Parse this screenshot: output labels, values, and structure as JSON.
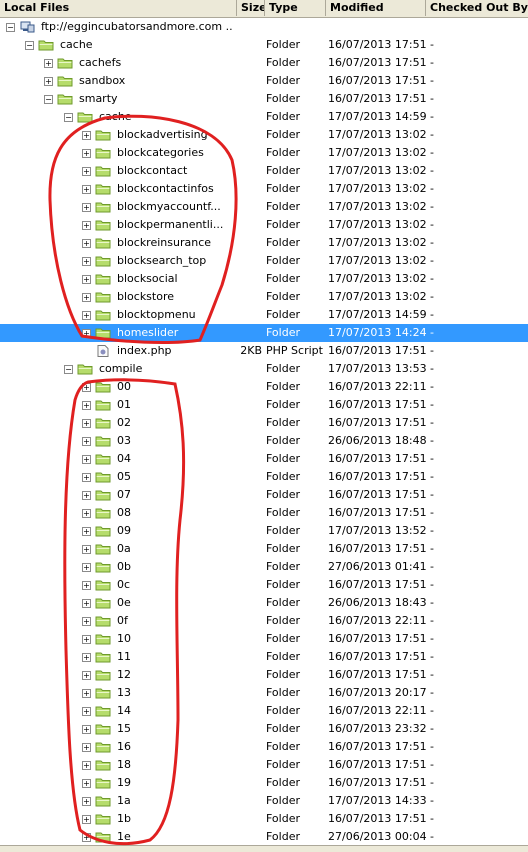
{
  "columns": {
    "local_files": "Local Files",
    "size": "Size",
    "type": "Type",
    "modified": "Modified",
    "checked_out_by": "Checked Out By"
  },
  "rows": [
    {
      "name": "ftp://eggincubatorsandmore.com ...",
      "size": "",
      "type": "",
      "modified": "",
      "checked": "",
      "level": 0,
      "icon": "server",
      "expander": "minus"
    },
    {
      "name": "cache",
      "size": "",
      "type": "Folder",
      "modified": "16/07/2013 17:51",
      "checked": "-",
      "level": 1,
      "icon": "folder",
      "expander": "minus"
    },
    {
      "name": "cachefs",
      "size": "",
      "type": "Folder",
      "modified": "16/07/2013 17:51",
      "checked": "-",
      "level": 2,
      "icon": "folder",
      "expander": "plus"
    },
    {
      "name": "sandbox",
      "size": "",
      "type": "Folder",
      "modified": "16/07/2013 17:51",
      "checked": "-",
      "level": 2,
      "icon": "folder",
      "expander": "plus"
    },
    {
      "name": "smarty",
      "size": "",
      "type": "Folder",
      "modified": "16/07/2013 17:51",
      "checked": "-",
      "level": 2,
      "icon": "folder",
      "expander": "minus"
    },
    {
      "name": "cache",
      "size": "",
      "type": "Folder",
      "modified": "17/07/2013 14:59",
      "checked": "-",
      "level": 3,
      "icon": "folder",
      "expander": "minus"
    },
    {
      "name": "blockadvertising",
      "size": "",
      "type": "Folder",
      "modified": "17/07/2013 13:02",
      "checked": "-",
      "level": 4,
      "icon": "folder",
      "expander": "plus"
    },
    {
      "name": "blockcategories",
      "size": "",
      "type": "Folder",
      "modified": "17/07/2013 13:02",
      "checked": "-",
      "level": 4,
      "icon": "folder",
      "expander": "plus"
    },
    {
      "name": "blockcontact",
      "size": "",
      "type": "Folder",
      "modified": "17/07/2013 13:02",
      "checked": "-",
      "level": 4,
      "icon": "folder",
      "expander": "plus"
    },
    {
      "name": "blockcontactinfos",
      "size": "",
      "type": "Folder",
      "modified": "17/07/2013 13:02",
      "checked": "-",
      "level": 4,
      "icon": "folder",
      "expander": "plus"
    },
    {
      "name": "blockmyaccountf...",
      "size": "",
      "type": "Folder",
      "modified": "17/07/2013 13:02",
      "checked": "-",
      "level": 4,
      "icon": "folder",
      "expander": "plus"
    },
    {
      "name": "blockpermanentli...",
      "size": "",
      "type": "Folder",
      "modified": "17/07/2013 13:02",
      "checked": "-",
      "level": 4,
      "icon": "folder",
      "expander": "plus"
    },
    {
      "name": "blockreinsurance",
      "size": "",
      "type": "Folder",
      "modified": "17/07/2013 13:02",
      "checked": "-",
      "level": 4,
      "icon": "folder",
      "expander": "plus"
    },
    {
      "name": "blocksearch_top",
      "size": "",
      "type": "Folder",
      "modified": "17/07/2013 13:02",
      "checked": "-",
      "level": 4,
      "icon": "folder",
      "expander": "plus"
    },
    {
      "name": "blocksocial",
      "size": "",
      "type": "Folder",
      "modified": "17/07/2013 13:02",
      "checked": "-",
      "level": 4,
      "icon": "folder",
      "expander": "plus"
    },
    {
      "name": "blockstore",
      "size": "",
      "type": "Folder",
      "modified": "17/07/2013 13:02",
      "checked": "-",
      "level": 4,
      "icon": "folder",
      "expander": "plus"
    },
    {
      "name": "blocktopmenu",
      "size": "",
      "type": "Folder",
      "modified": "17/07/2013 14:59",
      "checked": "-",
      "level": 4,
      "icon": "folder",
      "expander": "plus"
    },
    {
      "name": "homeslider",
      "size": "",
      "type": "Folder",
      "modified": "17/07/2013 14:24",
      "checked": "-",
      "level": 4,
      "icon": "folder",
      "expander": "plus",
      "selected": true
    },
    {
      "name": "index.php",
      "size": "2KB",
      "type": "PHP Script",
      "modified": "16/07/2013 17:51",
      "checked": "-",
      "level": 4,
      "icon": "file",
      "expander": "none"
    },
    {
      "name": "compile",
      "size": "",
      "type": "Folder",
      "modified": "17/07/2013 13:53",
      "checked": "-",
      "level": 3,
      "icon": "folder",
      "expander": "minus"
    },
    {
      "name": "00",
      "size": "",
      "type": "Folder",
      "modified": "16/07/2013 22:11",
      "checked": "-",
      "level": 4,
      "icon": "folder",
      "expander": "plus"
    },
    {
      "name": "01",
      "size": "",
      "type": "Folder",
      "modified": "16/07/2013 17:51",
      "checked": "-",
      "level": 4,
      "icon": "folder",
      "expander": "plus"
    },
    {
      "name": "02",
      "size": "",
      "type": "Folder",
      "modified": "16/07/2013 17:51",
      "checked": "-",
      "level": 4,
      "icon": "folder",
      "expander": "plus"
    },
    {
      "name": "03",
      "size": "",
      "type": "Folder",
      "modified": "26/06/2013 18:48",
      "checked": "-",
      "level": 4,
      "icon": "folder",
      "expander": "plus"
    },
    {
      "name": "04",
      "size": "",
      "type": "Folder",
      "modified": "16/07/2013 17:51",
      "checked": "-",
      "level": 4,
      "icon": "folder",
      "expander": "plus"
    },
    {
      "name": "05",
      "size": "",
      "type": "Folder",
      "modified": "16/07/2013 17:51",
      "checked": "-",
      "level": 4,
      "icon": "folder",
      "expander": "plus"
    },
    {
      "name": "07",
      "size": "",
      "type": "Folder",
      "modified": "16/07/2013 17:51",
      "checked": "-",
      "level": 4,
      "icon": "folder",
      "expander": "plus"
    },
    {
      "name": "08",
      "size": "",
      "type": "Folder",
      "modified": "16/07/2013 17:51",
      "checked": "-",
      "level": 4,
      "icon": "folder",
      "expander": "plus"
    },
    {
      "name": "09",
      "size": "",
      "type": "Folder",
      "modified": "17/07/2013 13:52",
      "checked": "-",
      "level": 4,
      "icon": "folder",
      "expander": "plus"
    },
    {
      "name": "0a",
      "size": "",
      "type": "Folder",
      "modified": "16/07/2013 17:51",
      "checked": "-",
      "level": 4,
      "icon": "folder",
      "expander": "plus"
    },
    {
      "name": "0b",
      "size": "",
      "type": "Folder",
      "modified": "27/06/2013 01:41",
      "checked": "-",
      "level": 4,
      "icon": "folder",
      "expander": "plus"
    },
    {
      "name": "0c",
      "size": "",
      "type": "Folder",
      "modified": "16/07/2013 17:51",
      "checked": "-",
      "level": 4,
      "icon": "folder",
      "expander": "plus"
    },
    {
      "name": "0e",
      "size": "",
      "type": "Folder",
      "modified": "26/06/2013 18:43",
      "checked": "-",
      "level": 4,
      "icon": "folder",
      "expander": "plus"
    },
    {
      "name": "0f",
      "size": "",
      "type": "Folder",
      "modified": "16/07/2013 22:11",
      "checked": "-",
      "level": 4,
      "icon": "folder",
      "expander": "plus"
    },
    {
      "name": "10",
      "size": "",
      "type": "Folder",
      "modified": "16/07/2013 17:51",
      "checked": "-",
      "level": 4,
      "icon": "folder",
      "expander": "plus"
    },
    {
      "name": "11",
      "size": "",
      "type": "Folder",
      "modified": "16/07/2013 17:51",
      "checked": "-",
      "level": 4,
      "icon": "folder",
      "expander": "plus"
    },
    {
      "name": "12",
      "size": "",
      "type": "Folder",
      "modified": "16/07/2013 17:51",
      "checked": "-",
      "level": 4,
      "icon": "folder",
      "expander": "plus"
    },
    {
      "name": "13",
      "size": "",
      "type": "Folder",
      "modified": "16/07/2013 20:17",
      "checked": "-",
      "level": 4,
      "icon": "folder",
      "expander": "plus"
    },
    {
      "name": "14",
      "size": "",
      "type": "Folder",
      "modified": "16/07/2013 22:11",
      "checked": "-",
      "level": 4,
      "icon": "folder",
      "expander": "plus"
    },
    {
      "name": "15",
      "size": "",
      "type": "Folder",
      "modified": "16/07/2013 23:32",
      "checked": "-",
      "level": 4,
      "icon": "folder",
      "expander": "plus"
    },
    {
      "name": "16",
      "size": "",
      "type": "Folder",
      "modified": "16/07/2013 17:51",
      "checked": "-",
      "level": 4,
      "icon": "folder",
      "expander": "plus"
    },
    {
      "name": "18",
      "size": "",
      "type": "Folder",
      "modified": "16/07/2013 17:51",
      "checked": "-",
      "level": 4,
      "icon": "folder",
      "expander": "plus"
    },
    {
      "name": "19",
      "size": "",
      "type": "Folder",
      "modified": "16/07/2013 17:51",
      "checked": "-",
      "level": 4,
      "icon": "folder",
      "expander": "plus"
    },
    {
      "name": "1a",
      "size": "",
      "type": "Folder",
      "modified": "17/07/2013 14:33",
      "checked": "-",
      "level": 4,
      "icon": "folder",
      "expander": "plus"
    },
    {
      "name": "1b",
      "size": "",
      "type": "Folder",
      "modified": "16/07/2013 17:51",
      "checked": "-",
      "level": 4,
      "icon": "folder",
      "expander": "plus"
    },
    {
      "name": "1e",
      "size": "",
      "type": "Folder",
      "modified": "27/06/2013 00:04",
      "checked": "-",
      "level": 4,
      "icon": "folder",
      "expander": "plus"
    }
  ],
  "colors": {
    "selection": "#3399ff",
    "folder": "#b6dc6b",
    "annotation": "#e02020"
  }
}
